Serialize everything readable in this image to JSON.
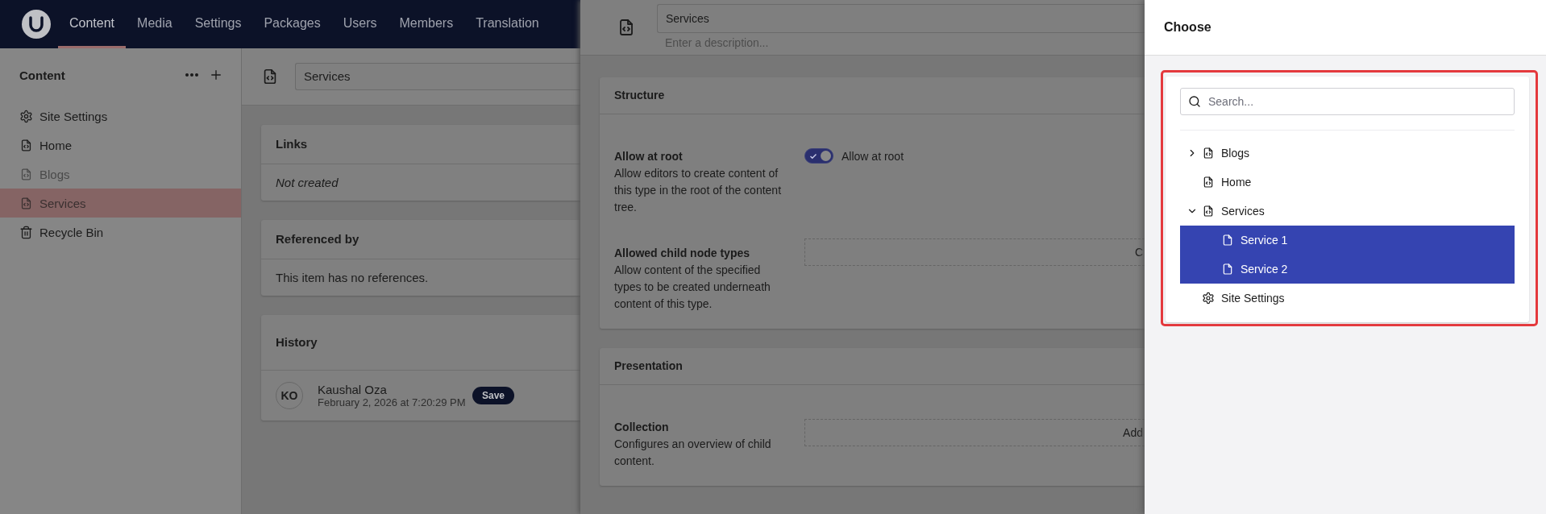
{
  "nav": {
    "tabs": [
      {
        "label": "Content",
        "selected": true
      },
      {
        "label": "Media",
        "selected": false
      },
      {
        "label": "Settings",
        "selected": false
      },
      {
        "label": "Packages",
        "selected": false
      },
      {
        "label": "Users",
        "selected": false
      },
      {
        "label": "Members",
        "selected": false
      },
      {
        "label": "Translation",
        "selected": false
      }
    ]
  },
  "sidebar": {
    "title": "Content",
    "items": [
      {
        "label": "Site Settings",
        "kind": "gear",
        "disabled": false,
        "selected": false
      },
      {
        "label": "Home",
        "kind": "doc-code",
        "disabled": false,
        "selected": false
      },
      {
        "label": "Blogs",
        "kind": "doc-code",
        "disabled": true,
        "selected": false
      },
      {
        "label": "Services",
        "kind": "doc-code",
        "disabled": true,
        "selected": true
      },
      {
        "label": "Recycle Bin",
        "kind": "trash",
        "disabled": false,
        "selected": false
      }
    ]
  },
  "workspace": {
    "name": "Services",
    "cards": [
      {
        "title": "Links",
        "kind": "note",
        "body": "Not created"
      },
      {
        "title": "Referenced by",
        "kind": "text",
        "body": "This item has no references."
      },
      {
        "title": "History",
        "kind": "history",
        "entries": [
          {
            "initials": "KO",
            "name": "Kaushal Oza",
            "date": "February 2, 2026 at 7:20:29 PM",
            "tag": "Save"
          }
        ]
      }
    ]
  },
  "editor": {
    "name": "Services",
    "description": {
      "placeholder": "Enter a description..."
    },
    "sections": [
      {
        "title": "Structure",
        "properties": [
          {
            "label": "Allow at root",
            "description": "Allow editors to create content of this type in the root of the content tree.",
            "kind": "toggle",
            "on": true,
            "value": "Allow at root"
          },
          {
            "label": "Allowed child node types",
            "description": "Allow content of the specified types to be created underneath content of this type.",
            "kind": "picker",
            "value": "C"
          }
        ]
      },
      {
        "title": "Presentation",
        "properties": [
          {
            "label": "Collection",
            "description": "Configures an overview of child content.",
            "kind": "picker",
            "value": "Add"
          }
        ]
      }
    ]
  },
  "picker": {
    "title": "Choose",
    "search": {
      "placeholder": "Search..."
    },
    "tree": [
      {
        "label": "Blogs",
        "kind": "doc-code",
        "expandable": true,
        "expanded": false,
        "selected": false
      },
      {
        "label": "Home",
        "kind": "doc-code",
        "selected": false
      },
      {
        "label": "Services",
        "kind": "doc-code",
        "expandable": true,
        "expanded": true,
        "selected": false,
        "children": [
          {
            "label": "Service 1",
            "kind": "doc",
            "selected": true
          },
          {
            "label": "Service 2",
            "kind": "doc",
            "selected": true
          }
        ]
      },
      {
        "label": "Site Settings",
        "kind": "gear",
        "selected": false
      }
    ]
  }
}
